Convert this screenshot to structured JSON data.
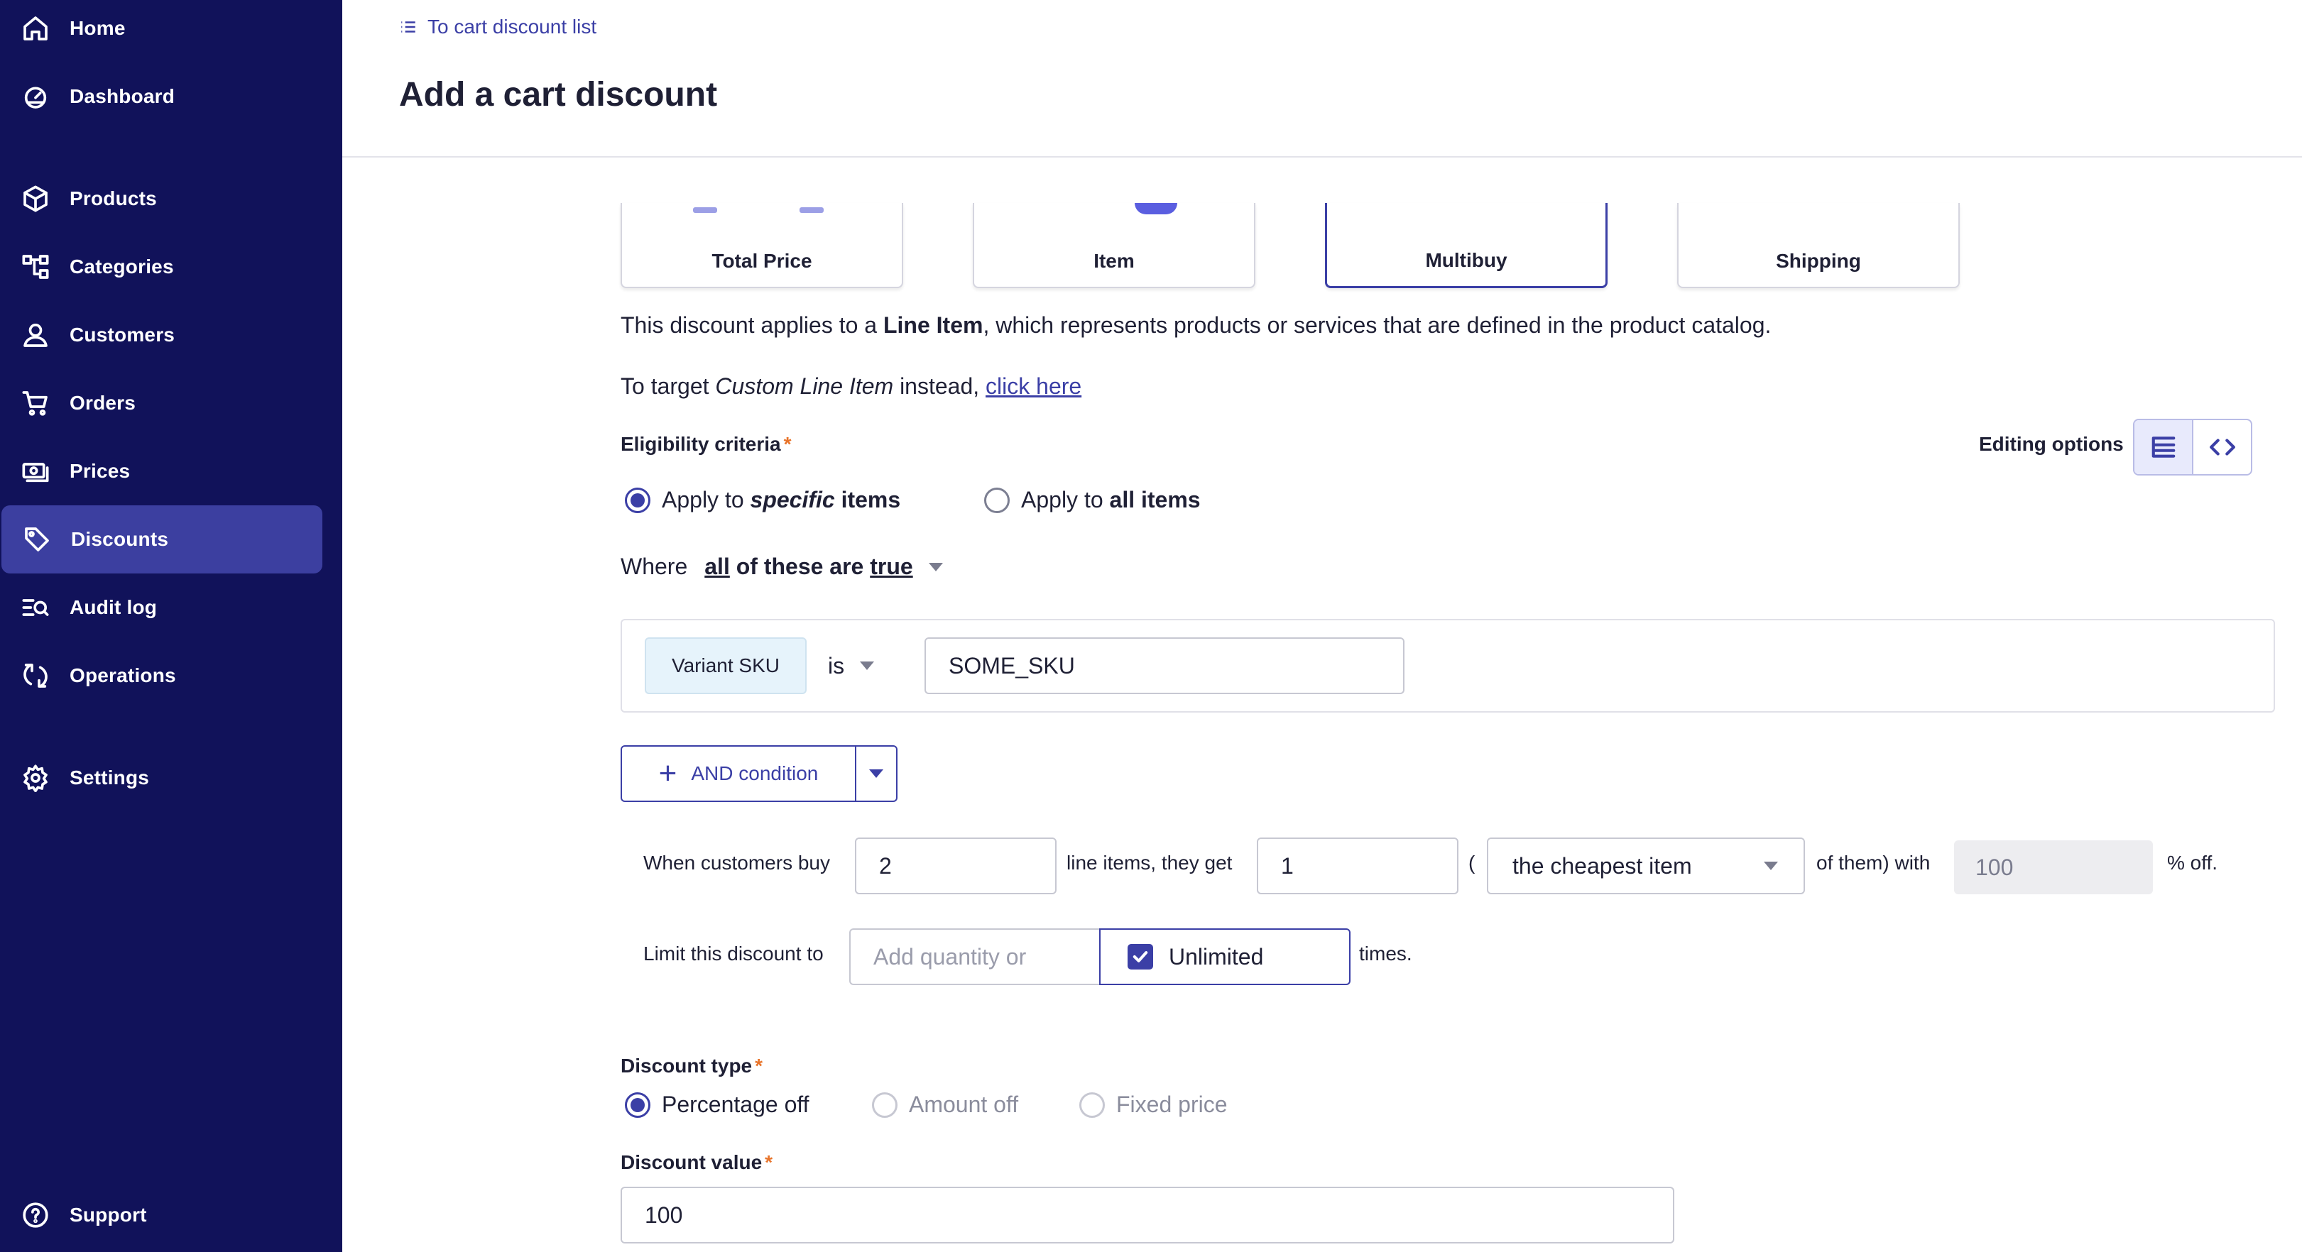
{
  "sidebar": {
    "items": [
      {
        "label": "Home",
        "icon": "home-icon"
      },
      {
        "label": "Dashboard",
        "icon": "gauge-icon"
      },
      {
        "label": "Products",
        "icon": "box-icon"
      },
      {
        "label": "Categories",
        "icon": "tree-icon"
      },
      {
        "label": "Customers",
        "icon": "user-icon"
      },
      {
        "label": "Orders",
        "icon": "cart-icon"
      },
      {
        "label": "Prices",
        "icon": "money-icon"
      },
      {
        "label": "Discounts",
        "icon": "tag-icon",
        "active": true
      },
      {
        "label": "Audit log",
        "icon": "search-list-icon"
      },
      {
        "label": "Operations",
        "icon": "sync-icon"
      },
      {
        "label": "Settings",
        "icon": "gear-icon"
      },
      {
        "label": "Support",
        "icon": "help-icon"
      }
    ]
  },
  "header": {
    "back_link": "To cart discount list",
    "title": "Add a cart discount"
  },
  "target_cards": [
    {
      "label": "Total Price"
    },
    {
      "label": "Item"
    },
    {
      "label": "Multibuy",
      "selected": true
    },
    {
      "label": "Shipping"
    }
  ],
  "description": {
    "line1_pre": "This discount applies to a ",
    "line1_bold": "Line Item",
    "line1_post": ", which represents products or services that are defined in the product catalog.",
    "line2_pre": "To target ",
    "line2_italic": "Custom Line Item",
    "line2_post": " instead, ",
    "line2_link": "click here"
  },
  "eligibility": {
    "label": "Eligibility criteria",
    "required": "*",
    "editing_options_label": "Editing options",
    "apply_specific_pre": "Apply to ",
    "apply_specific_em": "specific",
    "apply_specific_post": " items",
    "apply_all_pre": "Apply to ",
    "apply_all_bold": "all items",
    "where_label": "Where",
    "where_all": "all",
    "where_mid": " of these are ",
    "where_true": "true"
  },
  "condition": {
    "attribute": "Variant SKU",
    "operator": "is",
    "value": "SOME_SKU"
  },
  "and_condition": {
    "label": "AND condition"
  },
  "multibuy": {
    "when_buy": "When customers buy",
    "buy_qty": "2",
    "line_items_get": "line items, they get",
    "get_qty": "1",
    "paren_open": "(",
    "selection": "the cheapest item",
    "of_them_with": "of them) with",
    "percent_value": "100",
    "percent_off": "% off."
  },
  "limit": {
    "label": "Limit this discount to",
    "placeholder": "Add quantity or",
    "unlimited": "Unlimited",
    "times": "times."
  },
  "discount_type": {
    "label": "Discount type",
    "required": "*",
    "options": [
      "Percentage off",
      "Amount off",
      "Fixed price"
    ]
  },
  "discount_value": {
    "label": "Discount value",
    "required": "*",
    "value": "100"
  }
}
